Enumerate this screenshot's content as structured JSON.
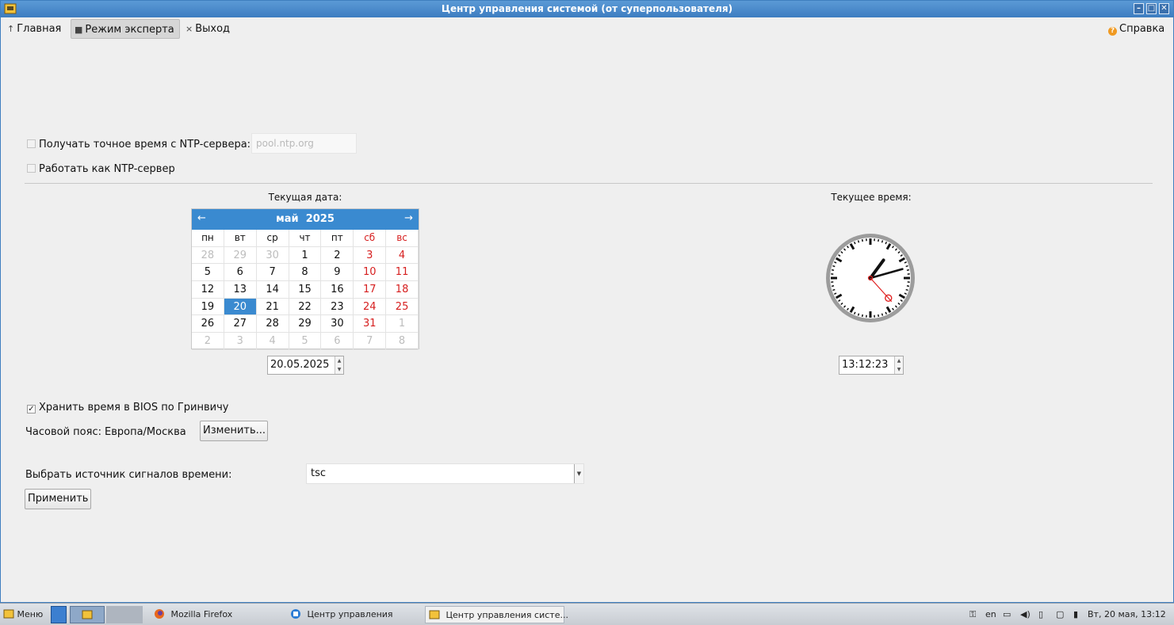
{
  "window": {
    "title": "Центр управления системой (от суперпользователя)",
    "controls": [
      "minimize",
      "maximize",
      "close"
    ]
  },
  "toolbar": {
    "home_label": "Главная",
    "expert_label": "Режим эксперта",
    "exit_label": "Выход",
    "help_label": "Справка"
  },
  "ntp": {
    "sync_label": "Получать точное время с NTP-сервера:",
    "sync_checked": false,
    "server_placeholder": "pool.ntp.org",
    "server_label": "Работать как NTP-сервер",
    "server_checked": false
  },
  "date_section": {
    "label": "Текущая дата:",
    "month": "май",
    "year": "2025",
    "weekdays": [
      "пн",
      "вт",
      "ср",
      "чт",
      "пт",
      "сб",
      "вс"
    ],
    "weeks": [
      [
        "28",
        "29",
        "30",
        "1",
        "2",
        "3",
        "4"
      ],
      [
        "5",
        "6",
        "7",
        "8",
        "9",
        "10",
        "11"
      ],
      [
        "12",
        "13",
        "14",
        "15",
        "16",
        "17",
        "18"
      ],
      [
        "19",
        "20",
        "21",
        "22",
        "23",
        "24",
        "25"
      ],
      [
        "26",
        "27",
        "28",
        "29",
        "30",
        "31",
        "1"
      ],
      [
        "2",
        "3",
        "4",
        "5",
        "6",
        "7",
        "8"
      ]
    ],
    "selected_day": "20",
    "date_value": "20.05.2025"
  },
  "time_section": {
    "label": "Текущее время:",
    "time_value": "13:12:23",
    "hour": 13,
    "minute": 12,
    "second": 23
  },
  "bios": {
    "label": "Хранить время в BIOS по Гринвичу",
    "checked": true
  },
  "timezone": {
    "label": "Часовой пояс:",
    "value": "Европа/Москва",
    "change_button": "Изменить..."
  },
  "clocksource": {
    "label": "Выбрать источник сигналов времени:",
    "value": "tsc"
  },
  "apply_button": "Применить",
  "taskbar": {
    "menu_label": "Меню",
    "tasks": [
      "Mozilla Firefox",
      "Центр управления",
      "Центр управления систе..."
    ],
    "lang": "en",
    "clock": "Вт, 20 мая, 13:12"
  },
  "colors": {
    "accent": "#3a8ad0",
    "weekend": "#d61f1f",
    "titlebar": "#4a8ccb"
  }
}
